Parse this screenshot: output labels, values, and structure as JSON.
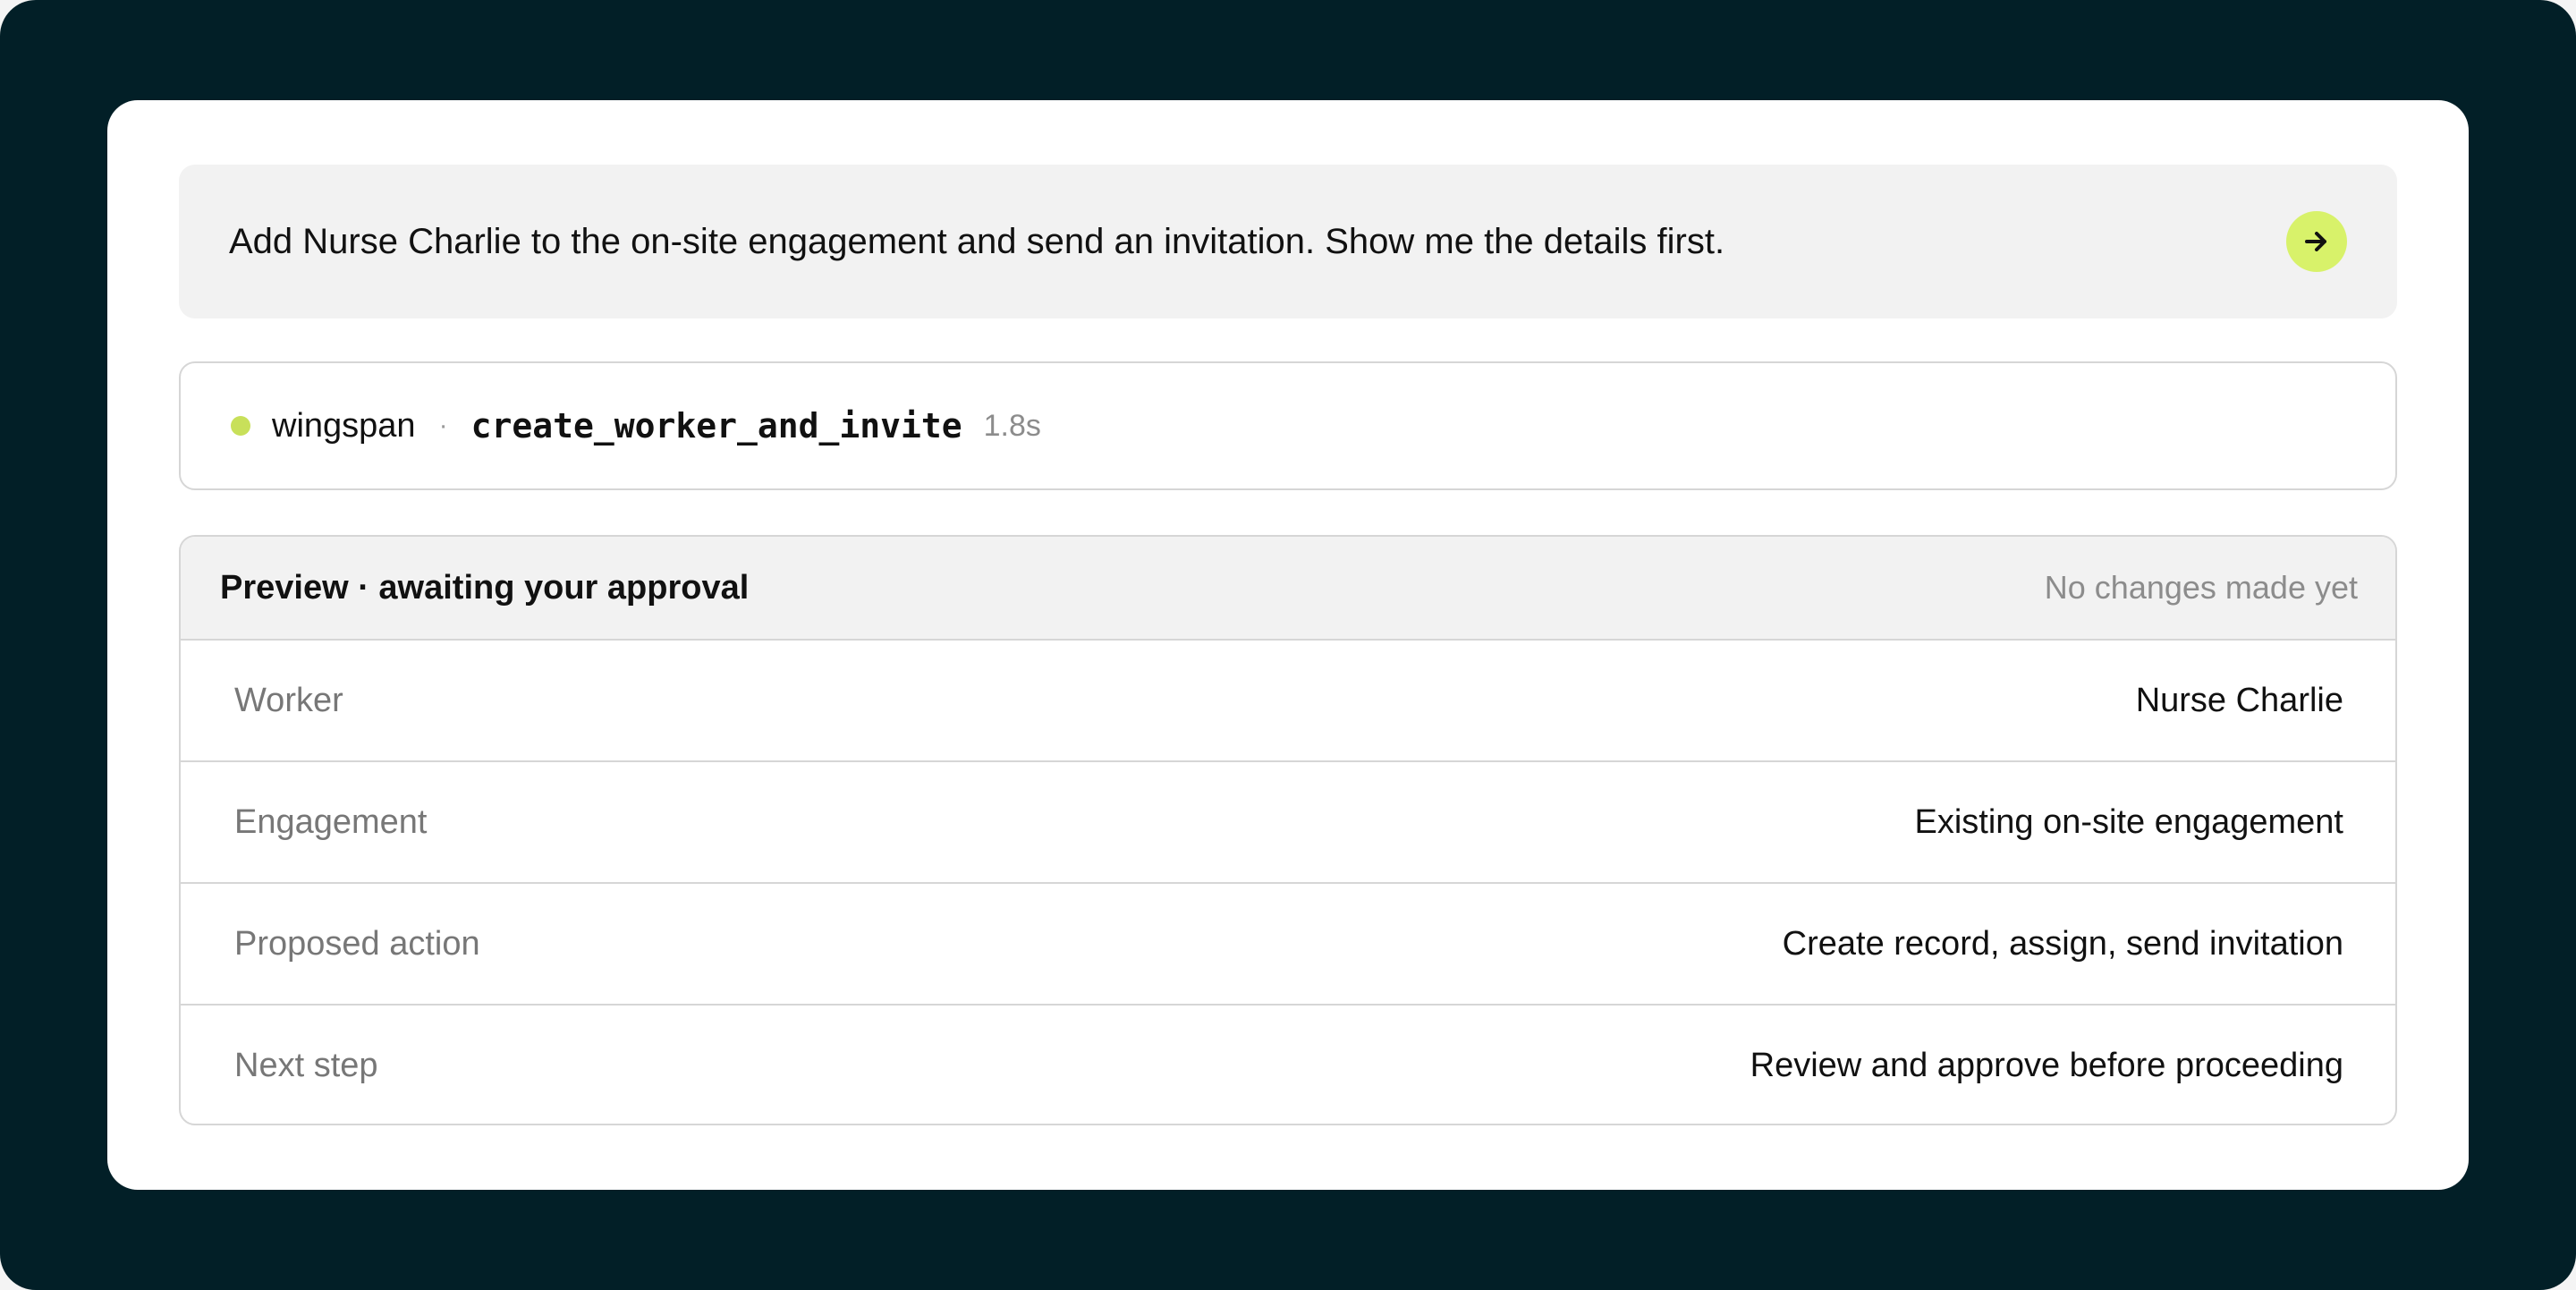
{
  "prompt": {
    "text": "Add Nurse Charlie to the on-site engagement and send an invitation. Show me the details first.",
    "send_icon": "arrow-right-icon"
  },
  "tool_call": {
    "status_color": "#c8e05a",
    "source": "wingspan",
    "separator": "·",
    "name": "create_worker_and_invite",
    "duration": "1.8s"
  },
  "preview": {
    "title": "Preview · awaiting your approval",
    "note": "No changes made yet",
    "rows": [
      {
        "label": "Worker",
        "value": "Nurse Charlie"
      },
      {
        "label": "Engagement",
        "value": "Existing on-site engagement"
      },
      {
        "label": "Proposed action",
        "value": "Create record, assign, send invitation"
      },
      {
        "label": "Next step",
        "value": "Review and approve before proceeding"
      }
    ]
  },
  "colors": {
    "frame_bg": "#021f27",
    "accent": "#d8f26a"
  }
}
